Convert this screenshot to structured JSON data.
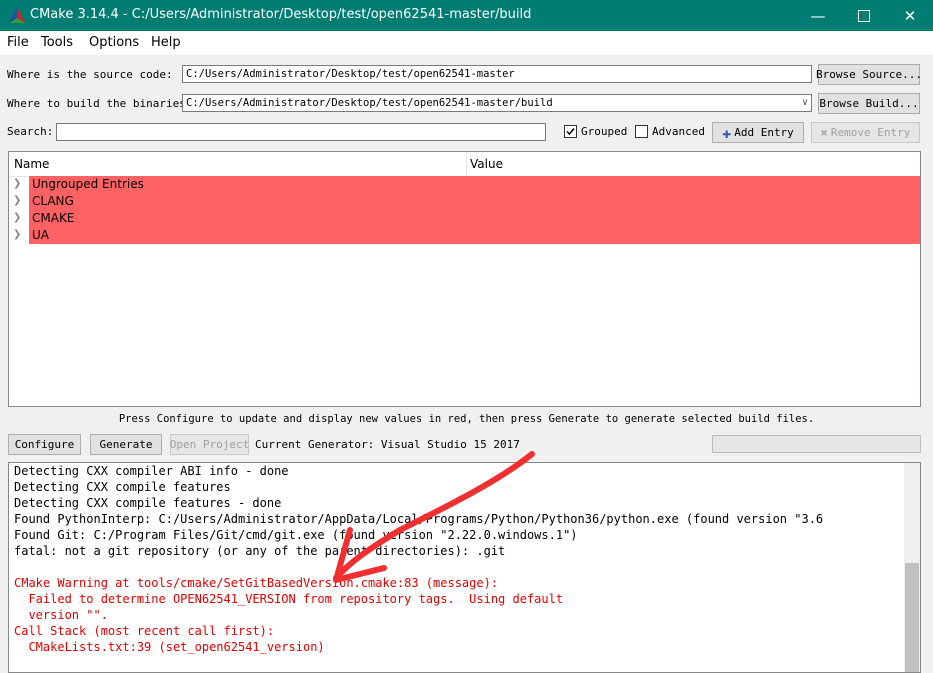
{
  "window": {
    "title": "CMake 3.14.4 - C:/Users/Administrator/Desktop/test/open62541-master/build"
  },
  "menu": {
    "file": "File",
    "tools": "Tools",
    "options": "Options",
    "help": "Help"
  },
  "source": {
    "label": "Where is the source code:",
    "value": "C:/Users/Administrator/Desktop/test/open62541-master",
    "browse": "Browse Source..."
  },
  "build": {
    "label": "Where to build the binaries:",
    "value": "C:/Users/Administrator/Desktop/test/open62541-master/build",
    "browse": "Browse Build..."
  },
  "search": {
    "label": "Search:",
    "value": ""
  },
  "options": {
    "grouped": "Grouped",
    "grouped_checked": true,
    "advanced": "Advanced",
    "advanced_checked": false,
    "add_entry": "Add Entry",
    "remove_entry": "Remove Entry"
  },
  "table": {
    "col_name": "Name",
    "col_value": "Value",
    "rows": [
      {
        "name": "Ungrouped Entries"
      },
      {
        "name": "CLANG"
      },
      {
        "name": "CMAKE"
      },
      {
        "name": "UA"
      }
    ]
  },
  "hint": "Press Configure to update and display new values in red, then press Generate to generate selected build files.",
  "actions": {
    "configure": "Configure",
    "generate": "Generate",
    "open_project": "Open Project",
    "generator": "Current Generator: Visual Studio 15 2017"
  },
  "output": {
    "lines": [
      {
        "text": "Detecting CXX compiler ABI info - done",
        "red": false
      },
      {
        "text": "Detecting CXX compile features",
        "red": false
      },
      {
        "text": "Detecting CXX compile features - done",
        "red": false
      },
      {
        "text": "Found PythonInterp: C:/Users/Administrator/AppData/Local/Programs/Python/Python36/python.exe (found version \"3.6",
        "red": false
      },
      {
        "text": "Found Git: C:/Program Files/Git/cmd/git.exe (found version \"2.22.0.windows.1\")",
        "red": false
      },
      {
        "text": "fatal: not a git repository (or any of the parent directories): .git",
        "red": false
      },
      {
        "text": "",
        "red": false
      },
      {
        "text": "CMake Warning at tools/cmake/SetGitBasedVersion.cmake:83 (message):",
        "red": true
      },
      {
        "text": "  Failed to determine OPEN62541_VERSION from repository tags.  Using default",
        "red": true
      },
      {
        "text": "  version \"\".",
        "red": true
      },
      {
        "text": "Call Stack (most recent call first):",
        "red": true
      },
      {
        "text": "  CMakeLists.txt:39 (set_open62541_version)",
        "red": true
      }
    ]
  },
  "colors": {
    "titlebar": "#007d72",
    "entry_highlight": "#ff6262",
    "warning_text": "#e00000",
    "annotation_arrow": "#f03030"
  }
}
